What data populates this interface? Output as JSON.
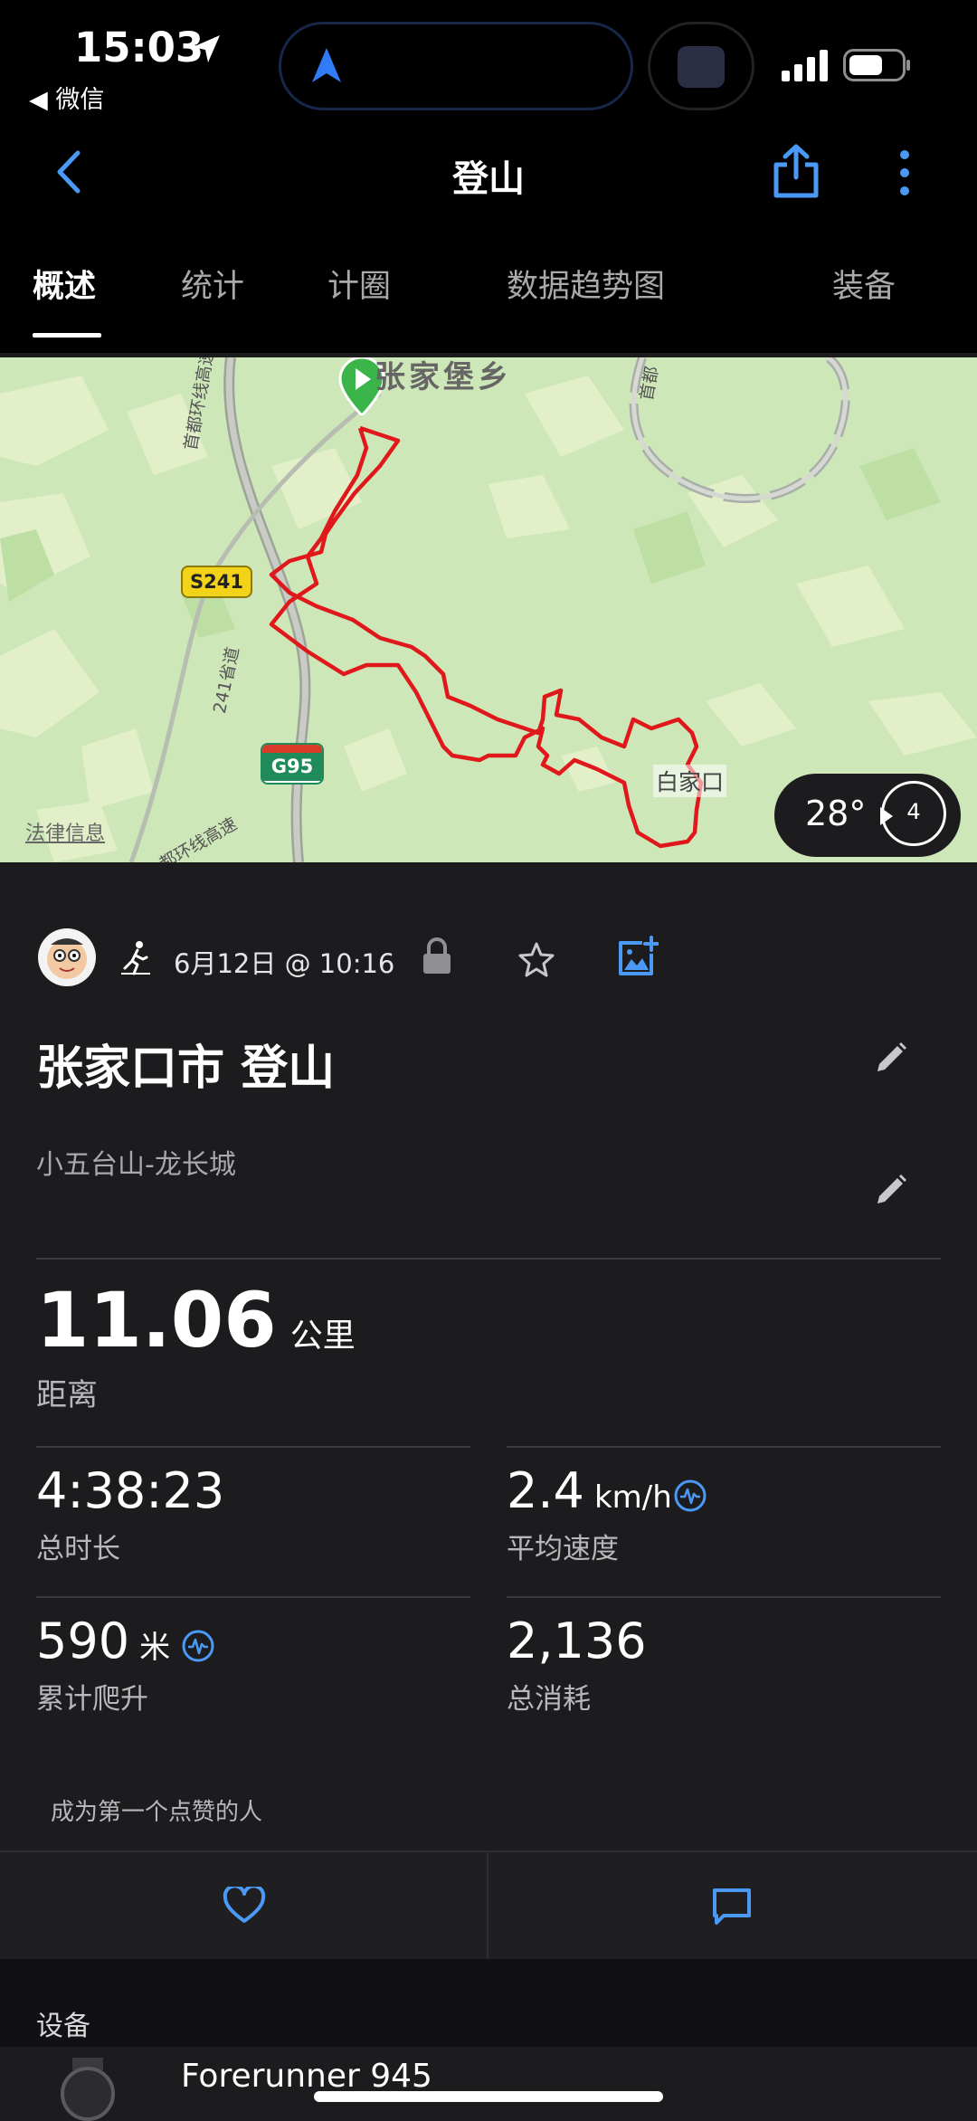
{
  "status_bar": {
    "time": "15:03",
    "back_app": "◀ 微信"
  },
  "header": {
    "title": "登山"
  },
  "tabs": [
    {
      "label": "概述"
    },
    {
      "label": "统计"
    },
    {
      "label": "计圈"
    },
    {
      "label": "数据趋势图"
    },
    {
      "label": "装备"
    }
  ],
  "map": {
    "place_top": "张家堡乡",
    "place_end": "白家口",
    "road_s241": "S241",
    "road_g95": "G95",
    "road_ring1": "首都环线高速",
    "road_ring2": "都环线高速",
    "road_ring3": "首都",
    "road_241": "241省道",
    "legal": "法律信息",
    "temperature": "28°",
    "wind": "4",
    "route_color": "#e0181b"
  },
  "activity": {
    "date_time": "6月12日 @ 10:16",
    "title": "张家口市 登山",
    "description": "小五台山-龙长城"
  },
  "stats": {
    "distance_value": "11.06",
    "distance_unit": "公里",
    "distance_label": "距离",
    "duration_value": "4:38:23",
    "duration_label": "总时长",
    "speed_value": "2.4",
    "speed_unit": "km/h",
    "speed_label": "平均速度",
    "ascent_value": "590",
    "ascent_unit": "米",
    "ascent_label": "累计爬升",
    "calories_value": "2,136",
    "calories_label": "总消耗"
  },
  "social": {
    "like_prompt": "成为第一个点赞的人"
  },
  "device_section": {
    "heading": "设备",
    "device_name": "Forerunner 945"
  },
  "colors": {
    "accent_blue": "#4a9af5",
    "background": "#1c1c1e"
  }
}
